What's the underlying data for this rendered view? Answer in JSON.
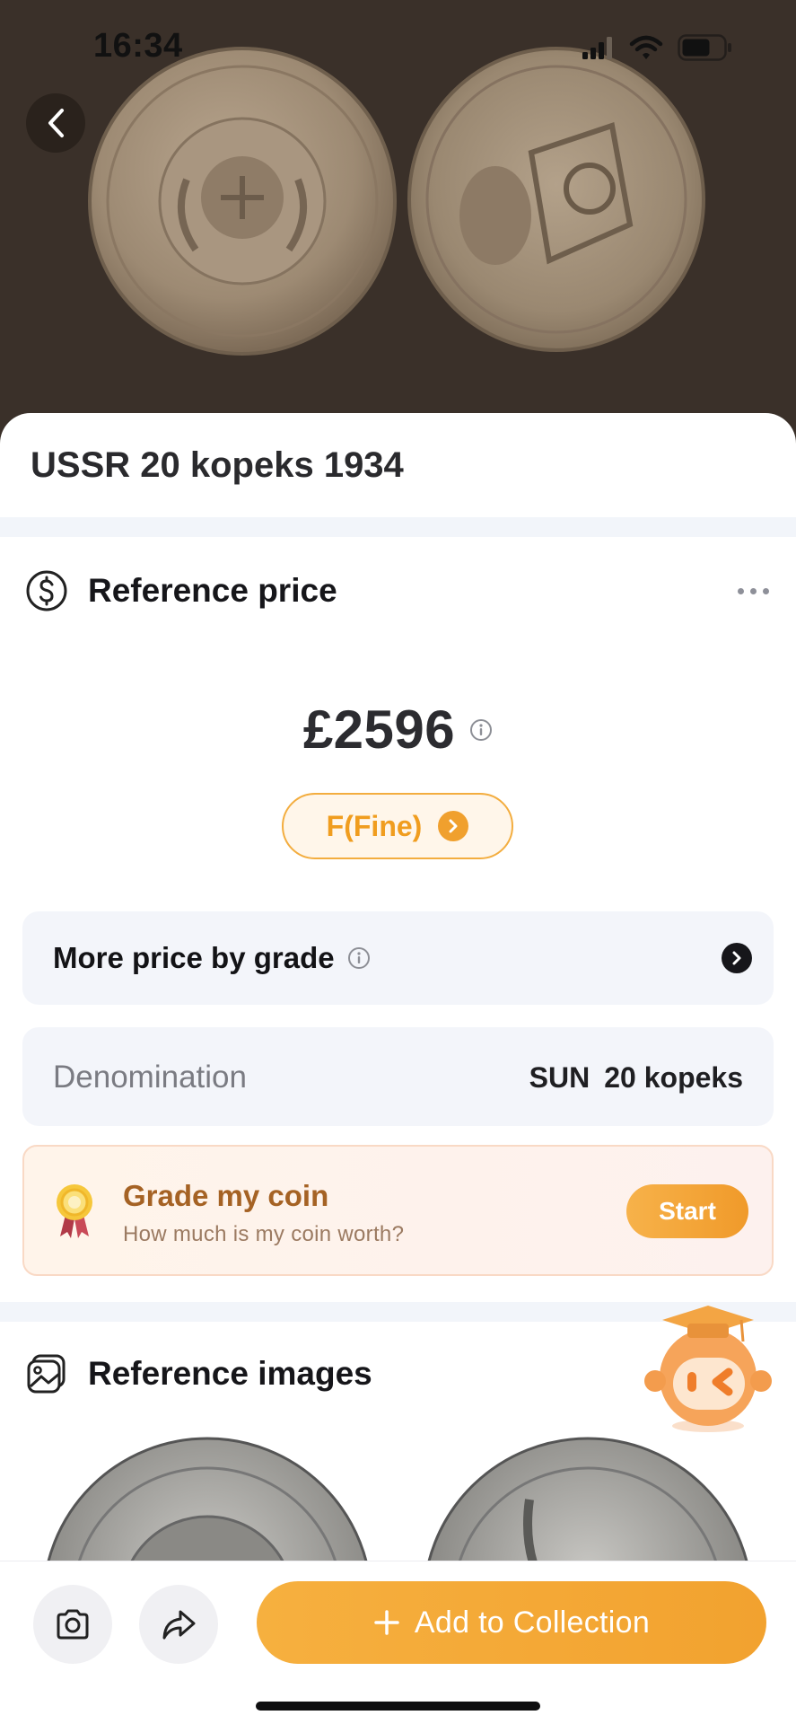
{
  "status_bar": {
    "time": "16:34"
  },
  "header": {
    "back_icon": "chevron-left-icon"
  },
  "coin": {
    "title": "USSR 20 kopeks 1934"
  },
  "reference_price": {
    "label": "Reference price",
    "icon": "dollar-circle-icon",
    "menu_icon": "more-horizontal-icon",
    "price": "£2596",
    "info_icon": "info-icon",
    "grade": "F(Fine)"
  },
  "more_price": {
    "label": "More price by grade",
    "info_icon": "info-icon",
    "arrow_icon": "chevron-right-icon"
  },
  "denomination": {
    "label": "Denomination",
    "unit": "SUN",
    "value": "20 kopeks"
  },
  "grade_card": {
    "icon": "medal-icon",
    "title": "Grade my coin",
    "subtitle": "How much is my coin worth?",
    "start_label": "Start"
  },
  "reference_images": {
    "label": "Reference images",
    "icon": "images-icon"
  },
  "bottom_bar": {
    "camera_icon": "camera-icon",
    "share_icon": "share-icon",
    "add_label": "Add to Collection",
    "add_icon": "plus-icon"
  },
  "colors": {
    "accent": "#F2A22F",
    "hero_bg": "#3A3029",
    "card_bg": "#F3F5FA"
  }
}
